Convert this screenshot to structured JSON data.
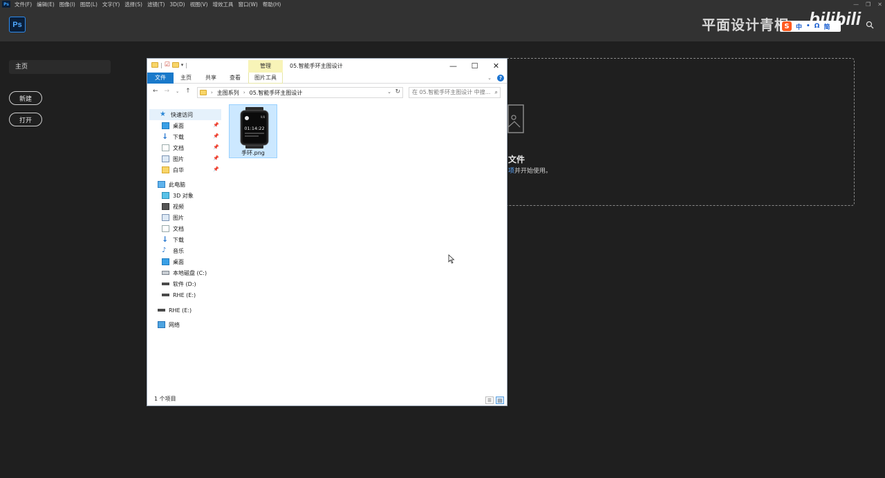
{
  "ps": {
    "menubar_logo": "Ps",
    "menu": [
      "文件(F)",
      "编辑(E)",
      "图像(I)",
      "图层(L)",
      "文字(Y)",
      "选择(S)",
      "滤镜(T)",
      "3D(D)",
      "视图(V)",
      "增效工具",
      "窗口(W)",
      "帮助(H)"
    ],
    "logo": "Ps",
    "home_label": "主页",
    "new_label": "新建",
    "open_label": "打开",
    "drop_title": "文件",
    "drop_sub_link": "项",
    "drop_sub_text": "并开始使用。"
  },
  "overlay": {
    "watermark": "平面设计青桐",
    "bilibili": "bilibili",
    "ime_logo": "S",
    "ime_items": [
      "中",
      "•",
      "Ω",
      "简"
    ]
  },
  "explorer": {
    "manage_tab": "管理",
    "title": "05.智能手环主图设计",
    "ribbon_tabs": {
      "file": "文件",
      "home": "主页",
      "share": "共享",
      "view": "查看",
      "pic_tools": "图片工具"
    },
    "breadcrumb": [
      "主图系列",
      "05.智能手环主图设计"
    ],
    "search_placeholder": "在 05.智能手环主图设计 中搜...",
    "nav": {
      "quick_access": "快速访问",
      "quick_items": [
        "桌面",
        "下载",
        "文档",
        "图片",
        "白华"
      ],
      "this_pc": "此电脑",
      "pc_items": [
        "3D 对象",
        "视频",
        "图片",
        "文档",
        "下载",
        "音乐",
        "桌面",
        "本地磁盘 (C:)",
        "软件 (D:)",
        "RHE (E:)"
      ],
      "rhe": "RHE (E:)",
      "network": "网络"
    },
    "file": {
      "name": "手环.png",
      "watch_time": "01:14:22",
      "watch_date": "9/8"
    },
    "status": "1 个项目"
  }
}
